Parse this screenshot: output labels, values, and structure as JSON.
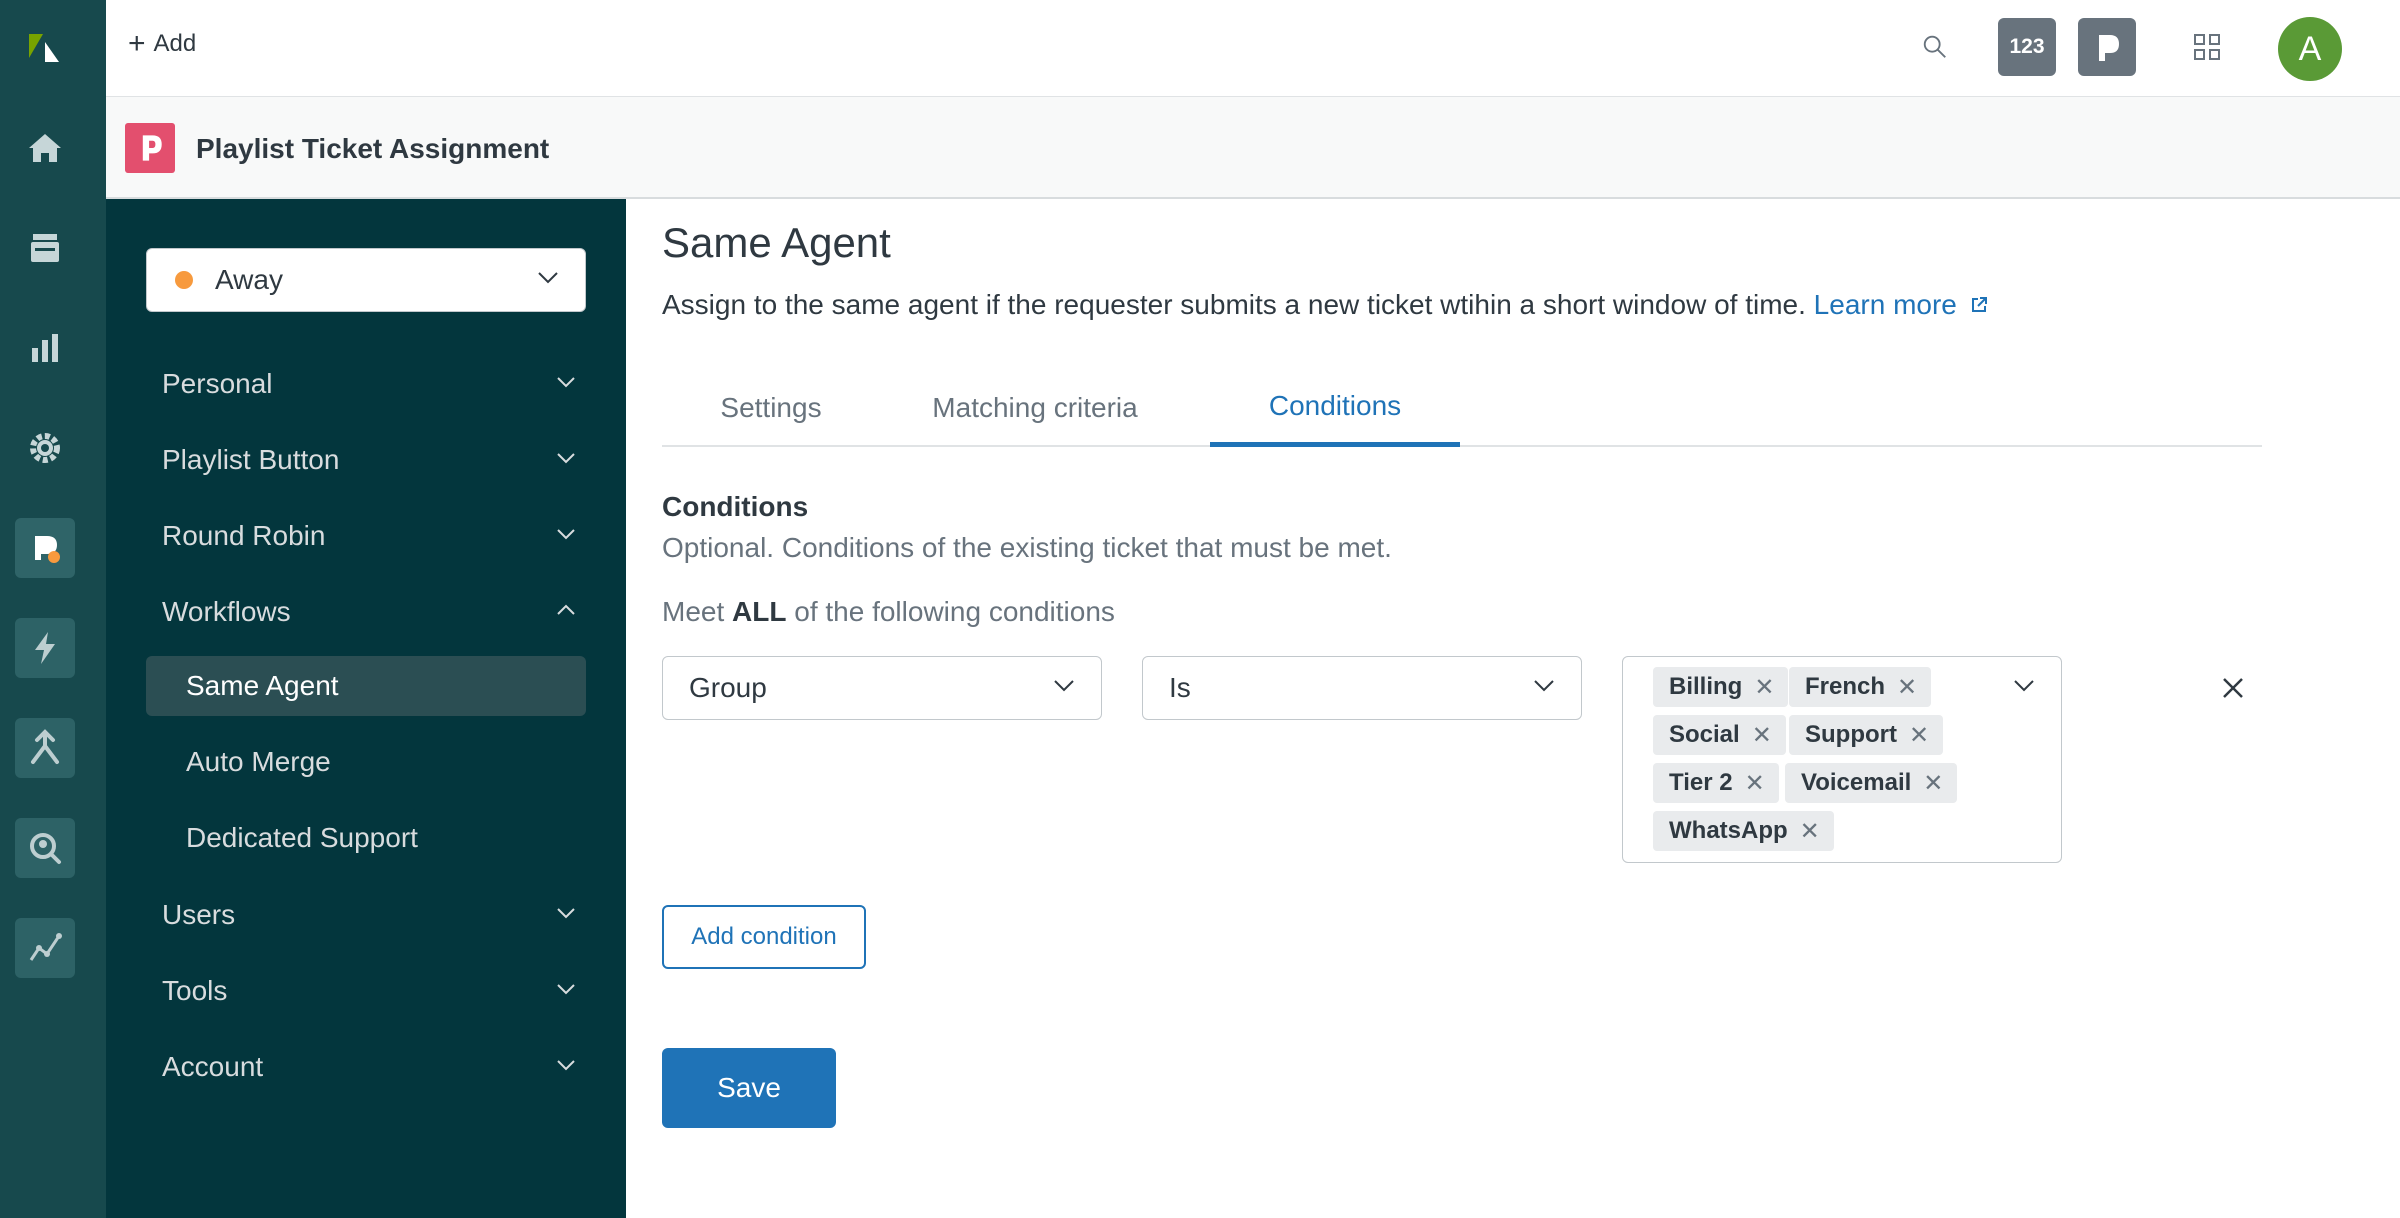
{
  "header": {
    "add_label": "Add",
    "notifications_badge": "123"
  },
  "avatar": {
    "initial": "A",
    "color": "#5a9a36"
  },
  "app": {
    "title": "Playlist Ticket Assignment",
    "logo_color": "#e34f6e"
  },
  "status": {
    "label": "Away",
    "color": "#f79a3e"
  },
  "nav": {
    "personal": "Personal",
    "playlist_button": "Playlist Button",
    "round_robin": "Round Robin",
    "workflows": "Workflows",
    "workflows_items": [
      "Same Agent",
      "Auto Merge",
      "Dedicated Support"
    ],
    "users": "Users",
    "tools": "Tools",
    "account": "Account"
  },
  "page": {
    "title": "Same Agent",
    "description": "Assign to the same agent if the requester submits a new ticket wtihin a short window of time.",
    "learn_more": "Learn more"
  },
  "tabs": [
    "Settings",
    "Matching criteria",
    "Conditions"
  ],
  "active_tab": "Conditions",
  "conditions": {
    "title": "Conditions",
    "description": "Optional. Conditions of the existing ticket that must be met.",
    "meet_prefix": "Meet",
    "meet_bold": "ALL",
    "meet_suffix": "of the following conditions",
    "field": "Group",
    "operator": "Is",
    "values": [
      "Billing",
      "French",
      "Social",
      "Support",
      "Tier 2",
      "Voicemail",
      "WhatsApp"
    ]
  },
  "buttons": {
    "add_condition": "Add condition",
    "save": "Save"
  },
  "colors": {
    "brand_blue": "#1f73b7",
    "nav_bg": "#03363d",
    "rail_bg": "#17494d"
  }
}
